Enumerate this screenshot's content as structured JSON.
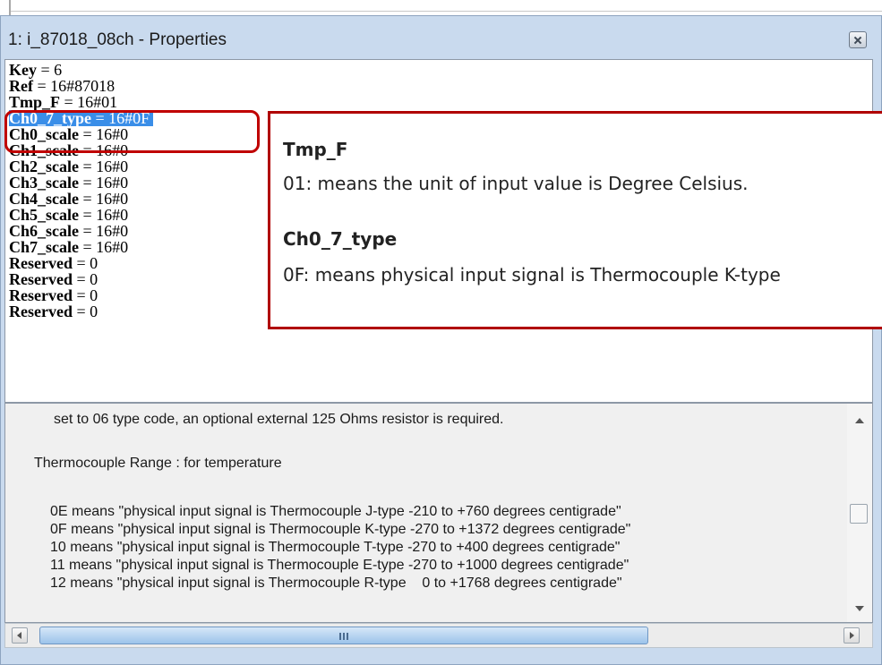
{
  "window": {
    "title": "1: i_87018_08ch - Properties"
  },
  "properties": [
    {
      "name": "Key",
      "value": "6"
    },
    {
      "name": "Ref",
      "value": "16#87018"
    },
    {
      "name": "Tmp_F",
      "value": "16#01"
    },
    {
      "name": "Ch0_7_type",
      "value": "16#0F",
      "selected": true
    },
    {
      "name": "Ch0_scale",
      "value": "16#0"
    },
    {
      "name": "Ch1_scale",
      "value": "16#0"
    },
    {
      "name": "Ch2_scale",
      "value": "16#0"
    },
    {
      "name": "Ch3_scale",
      "value": "16#0"
    },
    {
      "name": "Ch4_scale",
      "value": "16#0"
    },
    {
      "name": "Ch5_scale",
      "value": "16#0"
    },
    {
      "name": "Ch6_scale",
      "value": "16#0"
    },
    {
      "name": "Ch7_scale",
      "value": "16#0"
    },
    {
      "name": "Reserved",
      "value": "0"
    },
    {
      "name": "Reserved",
      "value": "0"
    },
    {
      "name": "Reserved",
      "value": "0"
    },
    {
      "name": "Reserved",
      "value": "0"
    }
  ],
  "callout": {
    "tmp_heading": "Tmp_F",
    "tmp_desc": "01: means the unit of input value is Degree Celsius.",
    "type_heading": "Ch0_7_type",
    "type_desc": "0F: means physical input signal is Thermocouple K-type"
  },
  "description": {
    "lines": [
      "set to 06 type code, an optional external 125 Ohms resistor is required.",
      "Thermocouple Range : for temperature",
      "0E means \"physical input signal is Thermocouple J-type -210 to +760 degrees centigrade\"",
      "0F means \"physical input signal is Thermocouple K-type -270 to +1372 degrees centigrade\"",
      "10 means \"physical input signal is Thermocouple T-type -270 to +400 degrees centigrade\"",
      "11 means \"physical input signal is Thermocouple E-type -270 to +1000 degrees centigrade\"",
      "12 means \"physical input signal is Thermocouple R-type    0 to +1768 degrees centigrade\""
    ]
  },
  "hscroll": {
    "grip": "III"
  },
  "icons": {
    "close": "close-icon",
    "scroll_up": "arrow-up-icon",
    "scroll_down": "arrow-down-icon",
    "scroll_left": "arrow-left-icon",
    "scroll_right": "arrow-right-icon"
  },
  "colors": {
    "selection": "#3a8ee8",
    "highlight_border": "#c00000",
    "window_frame": "#c9daee"
  }
}
